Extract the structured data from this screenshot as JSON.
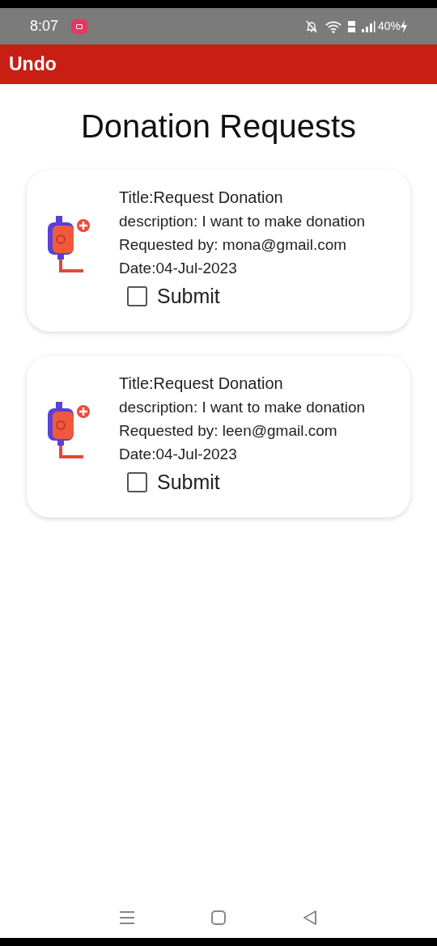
{
  "status_bar": {
    "time": "8:07",
    "battery": "40%"
  },
  "app_bar": {
    "action": "Undo"
  },
  "heading": "Donation Requests",
  "requests": [
    {
      "title": "Title:Request Donation",
      "description": "description: I want to make donation",
      "requested_by": "Requested by: mona@gmail.com",
      "date": "Date:04-Jul-2023",
      "submit_label": "Submit",
      "checked": false
    },
    {
      "title": "Title:Request Donation",
      "description": "description: I want to make donation",
      "requested_by": "Requested by: leen@gmail.com",
      "date": "Date:04-Jul-2023",
      "submit_label": "Submit",
      "checked": false
    }
  ]
}
